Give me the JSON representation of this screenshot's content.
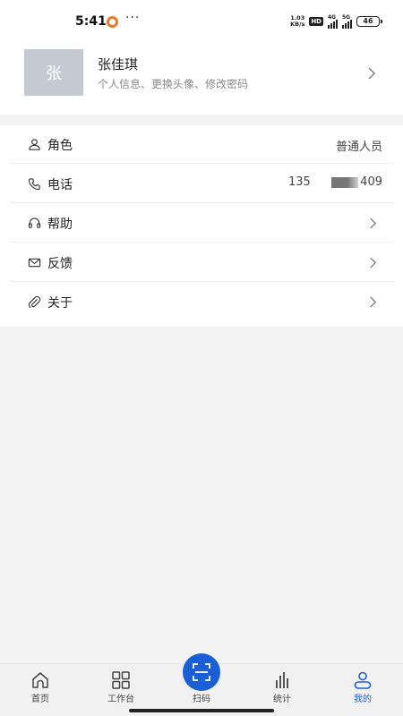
{
  "status_bar": {
    "time": "5:41",
    "more": "···",
    "speed_value": "1.03",
    "speed_unit": "KB/s",
    "hd": "HD",
    "network_1": "4G",
    "network_2": "5G",
    "battery": "46"
  },
  "profile": {
    "avatar_text": "张",
    "name": "张佳琪",
    "subtitle": "个人信息、更换头像、修改密码"
  },
  "menu": {
    "role": {
      "label": "角色",
      "value": "普通人员",
      "icon": "user-icon"
    },
    "phone": {
      "label": "电话",
      "value_prefix": "135",
      "value_suffix": "409",
      "icon": "phone-icon"
    },
    "help": {
      "label": "帮助",
      "icon": "headset-icon"
    },
    "feedback": {
      "label": "反馈",
      "icon": "mail-icon"
    },
    "about": {
      "label": "关于",
      "icon": "paperclip-icon"
    }
  },
  "tabs": [
    {
      "label": "首页",
      "icon": "home-icon"
    },
    {
      "label": "工作台",
      "icon": "grid-icon"
    },
    {
      "label": "扫码",
      "icon": "scan-icon"
    },
    {
      "label": "统计",
      "icon": "bar-chart-icon"
    },
    {
      "label": "我的",
      "icon": "person-icon",
      "active": true
    }
  ],
  "colors": {
    "accent": "#1a5fd6",
    "background": "#f4f4f5",
    "avatar": "#c5c9d1"
  }
}
